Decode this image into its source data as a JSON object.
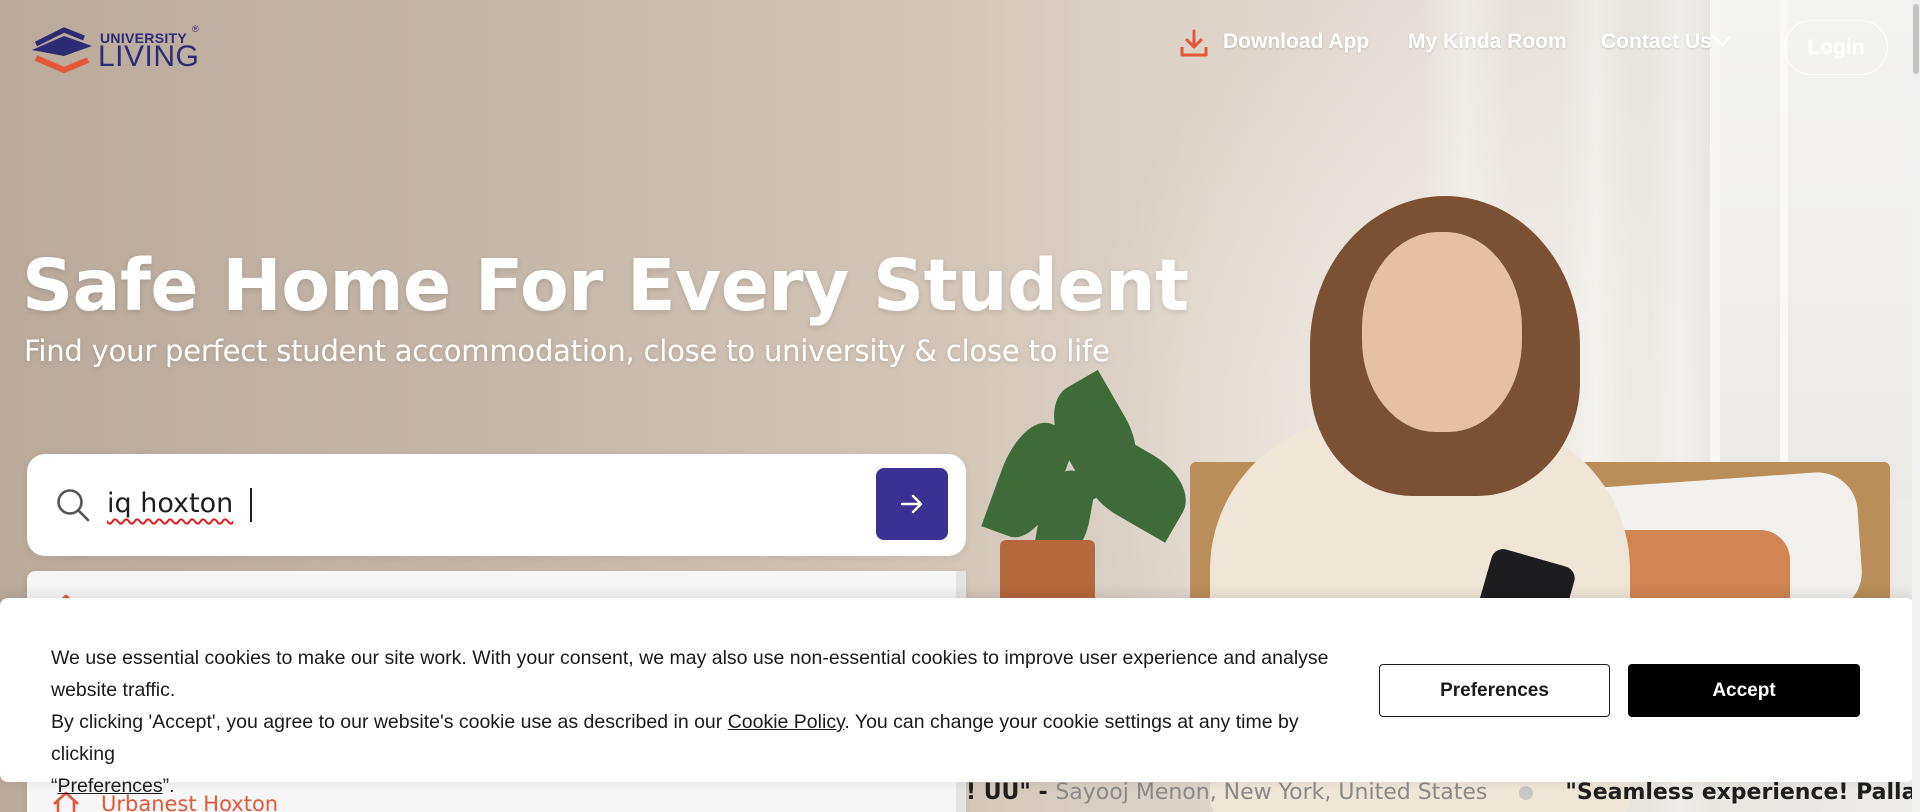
{
  "brand": {
    "logo_top": "UNIVERSITY",
    "logo_bottom": "LIVING",
    "registered_mark": "®",
    "accent_color": "#3a3192",
    "secondary_color": "#e4583a"
  },
  "nav": {
    "download_label": "Download App",
    "download_icon": "download-icon",
    "room_label": "My Kinda Room",
    "contact_label": "Contact Us",
    "contact_icon": "chevron-down-icon",
    "login_label": "Login"
  },
  "hero": {
    "title": "Safe Home For Every Student",
    "subtitle": "Find your perfect student accommodation, close to university & close to life"
  },
  "search": {
    "value": "iq hoxton",
    "icon": "search-icon",
    "submit_icon": "arrow-right-icon"
  },
  "dropdown": {
    "items": [
      {
        "label": "",
        "icon": "home-icon"
      },
      {
        "label": "Urbanest Hoxton",
        "icon": "home-icon"
      }
    ]
  },
  "testimonials": [
    {
      "quote": "! UU\" - ",
      "author": "Sayooj Menon, New York, United States"
    },
    {
      "quote": "\"Seamless experience! Pallavi wa",
      "author": ""
    }
  ],
  "cookie": {
    "line1": "We use essential cookies to make our site work. With your consent, we may also use non-essential cookies to improve user experience and analyse website traffic.",
    "line2_before": "By clicking 'Accept', you agree to our website's cookie use as described in our ",
    "policy_link": "Cookie Policy",
    "line2_after": ". You can change your cookie settings at any time by clicking",
    "line3_open": "“",
    "preferences_link": "Preferences",
    "line3_close": "”.",
    "preferences_button": "Preferences",
    "accept_button": "Accept"
  }
}
